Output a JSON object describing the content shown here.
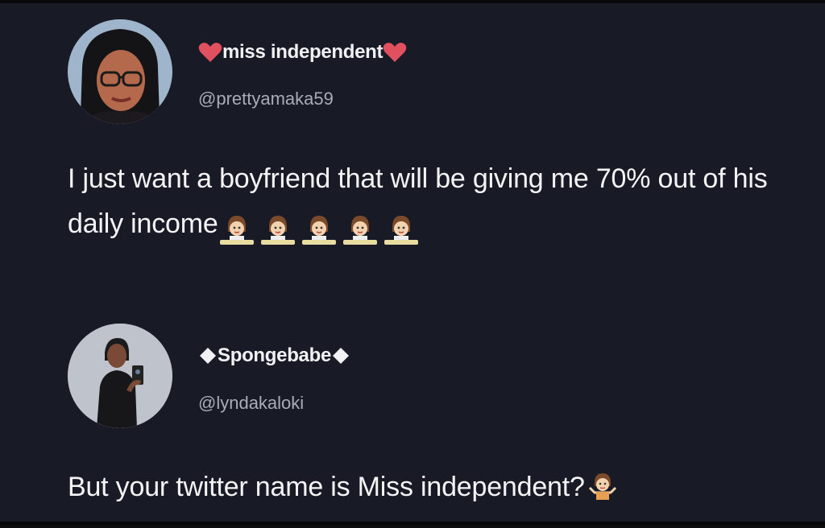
{
  "tweets": [
    {
      "display_name": "miss independent",
      "name_decoration": "heart-icon",
      "handle": "@prettyamaka59",
      "text": "I just want a boyfriend that will be giving me 70% out of his daily income",
      "trailing_emoji": "woman-tipping-hand-emoji",
      "trailing_emoji_count": 5
    },
    {
      "display_name": "Spongebabe",
      "name_decoration": "diamond-icon",
      "handle": "@lyndakaloki",
      "text": "But your twitter name is Miss independent?",
      "trailing_emoji": "woman-shrugging-emoji",
      "trailing_emoji_count": 1
    }
  ],
  "colors": {
    "background": "#181b26",
    "text": "#f4f4f6",
    "handle": "#a9acb6",
    "heart": "#e0505e"
  }
}
